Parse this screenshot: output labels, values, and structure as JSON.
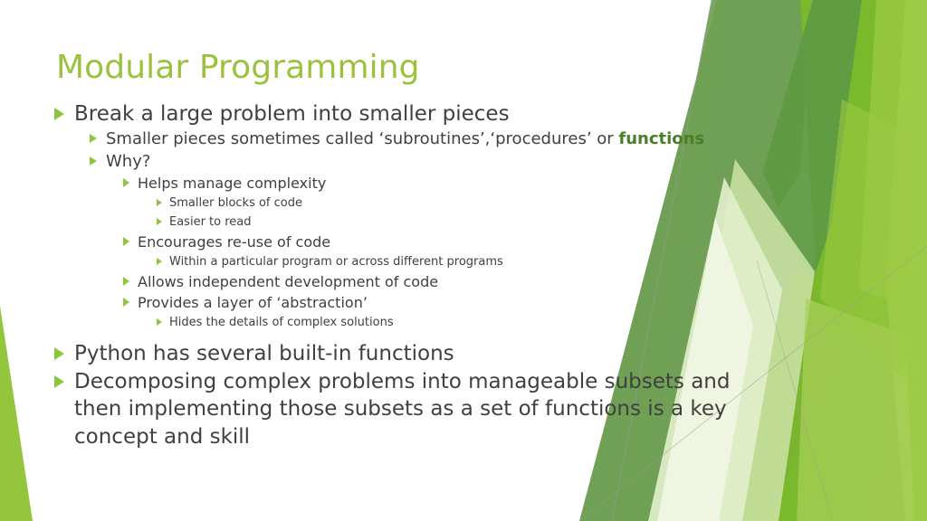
{
  "slide": {
    "title": "Modular Programming",
    "title_color": "#9ac23e",
    "body_text_color": "#404040",
    "bullet_marker_color": "#8cc63e",
    "highlight_color": "#4a7f28",
    "background_color": "#ffffff"
  },
  "bullets": {
    "b1": "Break a large problem into smaller pieces",
    "b2_pre": "Smaller pieces sometimes called ‘subroutines’,‘procedures’ or ",
    "b2_highlight": "functions",
    "b3": "Why?",
    "b4": "Helps manage complexity",
    "b5": "Smaller blocks of code",
    "b6": "Easier to read",
    "b7": "Encourages re-use of code",
    "b8": "Within a particular program or across different programs",
    "b9": "Allows independent development of code",
    "b10": "Provides a layer of ‘abstraction’",
    "b11": "Hides the details of complex solutions",
    "b12": "Python has several built-in functions",
    "b13": "Decomposing complex problems into manageable subsets and then implementing those subsets as a set of functions is a key concept and skill"
  },
  "decoration": {
    "name": "green-polygon-facet-background",
    "palette": {
      "olive_green": "#6fa055",
      "mid_green": "#5f9b43",
      "bright_green": "#7ab82c",
      "yellow_green": "#93c63c",
      "light_green": "#a9d05a",
      "pale_green": "#cde3a6",
      "very_pale_green": "#e2eecb",
      "faint_green": "#eff6e2",
      "hairline_gray": "#9a9a9a"
    }
  }
}
